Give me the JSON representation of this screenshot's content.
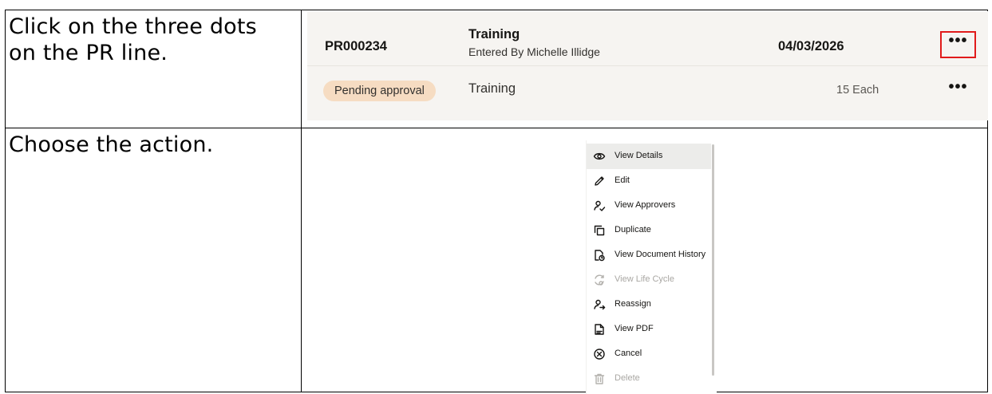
{
  "instructions": {
    "step1": "Click on the three dots on the PR line.",
    "step2": "Choose the action."
  },
  "requisition": {
    "number": "PR000234",
    "title": "Training",
    "entered_by": "Entered By Michelle Illidge",
    "date": "04/03/2026",
    "status_badge": "Pending approval",
    "line_description": "Training",
    "line_quantity": "15 Each",
    "more_actions_glyph": "•••",
    "highlight_color": "#e11b1b",
    "badge_color": "#f6dcc2"
  },
  "actions_menu": {
    "items": [
      {
        "label": "View Details",
        "icon": "eye-icon",
        "state": "hover"
      },
      {
        "label": "Edit",
        "icon": "pencil-icon",
        "state": "enabled"
      },
      {
        "label": "View Approvers",
        "icon": "person-check-icon",
        "state": "enabled"
      },
      {
        "label": "Duplicate",
        "icon": "duplicate-icon",
        "state": "enabled"
      },
      {
        "label": "View Document History",
        "icon": "document-history-icon",
        "state": "enabled"
      },
      {
        "label": "View Life Cycle",
        "icon": "life-cycle-icon",
        "state": "disabled"
      },
      {
        "label": "Reassign",
        "icon": "person-reassign-icon",
        "state": "enabled"
      },
      {
        "label": "View PDF",
        "icon": "pdf-file-icon",
        "state": "enabled"
      },
      {
        "label": "Cancel",
        "icon": "circle-x-icon",
        "state": "enabled"
      },
      {
        "label": "Delete",
        "icon": "trash-icon",
        "state": "disabled"
      }
    ]
  }
}
